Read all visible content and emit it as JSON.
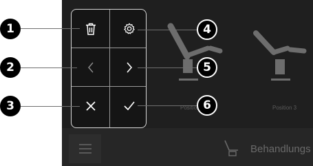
{
  "positions": [
    {
      "label": "Position 2"
    },
    {
      "label": "Position 3"
    }
  ],
  "bottom_bar": {
    "title": "Behandlungs",
    "menu_icon": "hamburger-menu-icon",
    "chair_icon": "treatment-chair-icon"
  },
  "popup": {
    "buttons": [
      {
        "id": "delete",
        "icon": "trash-icon"
      },
      {
        "id": "settings",
        "icon": "gear-icon"
      },
      {
        "id": "previous",
        "icon": "chevron-left-icon"
      },
      {
        "id": "next",
        "icon": "chevron-right-icon"
      },
      {
        "id": "cancel",
        "icon": "close-icon"
      },
      {
        "id": "confirm",
        "icon": "check-icon"
      }
    ]
  },
  "callouts": [
    "1",
    "2",
    "3",
    "4",
    "5",
    "6"
  ],
  "colors": {
    "screen_bg": "#1c1c1c",
    "bottom_bar_bg": "#262626",
    "popup_border": "#d8d8d8",
    "badge_bg": "#000000"
  }
}
